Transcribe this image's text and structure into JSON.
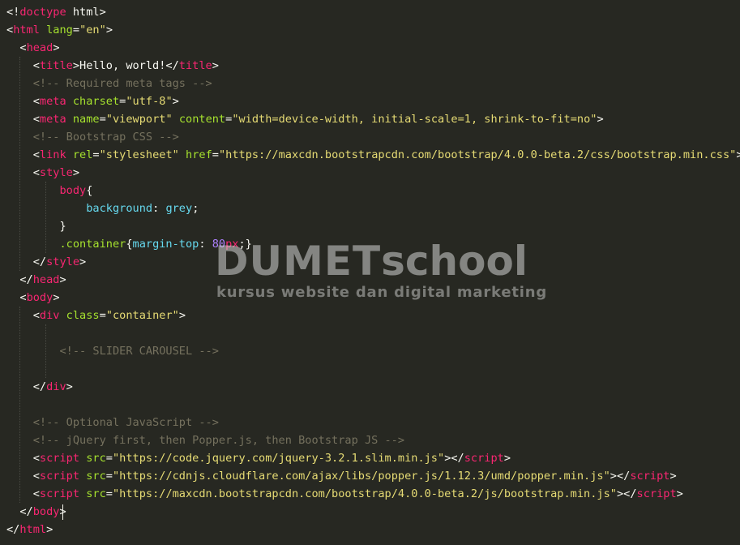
{
  "colors": {
    "background": "#272822",
    "tag": "#f92672",
    "attribute": "#a6e22e",
    "string": "#e6db74",
    "comment": "#75715e",
    "number": "#ae81ff",
    "css_property": "#66d9ef",
    "text": "#f8f8f2"
  },
  "watermark": {
    "brand_main": "DUMET",
    "brand_suffix": "school",
    "tagline": "kursus website dan digital marketing"
  },
  "code": {
    "lines": [
      [
        [
          "pl",
          "<!"
        ],
        [
          "tag",
          "doctype"
        ],
        [
          "pl",
          " html>"
        ]
      ],
      [
        [
          "pl",
          "<"
        ],
        [
          "tag",
          "html"
        ],
        [
          "pl",
          " "
        ],
        [
          "attr",
          "lang"
        ],
        [
          "pl",
          "="
        ],
        [
          "str",
          "\"en\""
        ],
        [
          "pl",
          ">"
        ]
      ],
      [
        [
          "pl",
          "  <"
        ],
        [
          "tag",
          "head"
        ],
        [
          "pl",
          ">"
        ]
      ],
      [
        [
          "pl",
          "    <"
        ],
        [
          "tag",
          "title"
        ],
        [
          "pl",
          ">Hello, world!</"
        ],
        [
          "tag",
          "title"
        ],
        [
          "pl",
          ">"
        ]
      ],
      [
        [
          "cm",
          "    <!-- Required meta tags -->"
        ]
      ],
      [
        [
          "pl",
          "    <"
        ],
        [
          "tag",
          "meta"
        ],
        [
          "pl",
          " "
        ],
        [
          "attr",
          "charset"
        ],
        [
          "pl",
          "="
        ],
        [
          "str",
          "\"utf-8\""
        ],
        [
          "pl",
          ">"
        ]
      ],
      [
        [
          "pl",
          "    <"
        ],
        [
          "tag",
          "meta"
        ],
        [
          "pl",
          " "
        ],
        [
          "attr",
          "name"
        ],
        [
          "pl",
          "="
        ],
        [
          "str",
          "\"viewport\""
        ],
        [
          "pl",
          " "
        ],
        [
          "attr",
          "content"
        ],
        [
          "pl",
          "="
        ],
        [
          "str",
          "\"width=device-width, initial-scale=1, shrink-to-fit=no\""
        ],
        [
          "pl",
          ">"
        ]
      ],
      [
        [
          "cm",
          "    <!-- Bootstrap CSS -->"
        ]
      ],
      [
        [
          "pl",
          "    <"
        ],
        [
          "tag",
          "link"
        ],
        [
          "pl",
          " "
        ],
        [
          "attr",
          "rel"
        ],
        [
          "pl",
          "="
        ],
        [
          "str",
          "\"stylesheet\""
        ],
        [
          "pl",
          " "
        ],
        [
          "attr",
          "href"
        ],
        [
          "pl",
          "="
        ],
        [
          "str",
          "\"https://maxcdn.bootstrapcdn.com/bootstrap/4.0.0-beta.2/css/bootstrap.min.css\""
        ],
        [
          "pl",
          ">"
        ]
      ],
      [
        [
          "pl",
          "    <"
        ],
        [
          "tag",
          "style"
        ],
        [
          "pl",
          ">"
        ]
      ],
      [
        [
          "pl",
          "        "
        ],
        [
          "tag",
          "body"
        ],
        [
          "pl",
          "{"
        ]
      ],
      [
        [
          "pl",
          "            "
        ],
        [
          "kw",
          "background"
        ],
        [
          "pl",
          ": "
        ],
        [
          "kw",
          "grey"
        ],
        [
          "pl",
          ";"
        ]
      ],
      [
        [
          "pl",
          "        }"
        ]
      ],
      [
        [
          "pl",
          "        "
        ],
        [
          "attr",
          ".container"
        ],
        [
          "pl",
          "{"
        ],
        [
          "kw",
          "margin-top"
        ],
        [
          "pl",
          ": "
        ],
        [
          "num",
          "80"
        ],
        [
          "tag",
          "px"
        ],
        [
          "pl",
          ";}"
        ]
      ],
      [
        [
          "pl",
          "    </"
        ],
        [
          "tag",
          "style"
        ],
        [
          "pl",
          ">"
        ]
      ],
      [
        [
          "pl",
          "  </"
        ],
        [
          "tag",
          "head"
        ],
        [
          "pl",
          ">"
        ]
      ],
      [
        [
          "pl",
          "  <"
        ],
        [
          "tag",
          "body"
        ],
        [
          "pl",
          ">"
        ]
      ],
      [
        [
          "pl",
          "    <"
        ],
        [
          "tag",
          "div"
        ],
        [
          "pl",
          " "
        ],
        [
          "attr",
          "class"
        ],
        [
          "pl",
          "="
        ],
        [
          "str",
          "\"container\""
        ],
        [
          "pl",
          ">"
        ]
      ],
      [],
      [
        [
          "cm",
          "        <!-- SLIDER CAROUSEL -->"
        ]
      ],
      [],
      [
        [
          "pl",
          "    </"
        ],
        [
          "tag",
          "div"
        ],
        [
          "pl",
          ">"
        ]
      ],
      [],
      [
        [
          "cm",
          "    <!-- Optional JavaScript -->"
        ]
      ],
      [
        [
          "cm",
          "    <!-- jQuery first, then Popper.js, then Bootstrap JS -->"
        ]
      ],
      [
        [
          "pl",
          "    <"
        ],
        [
          "tag",
          "script"
        ],
        [
          "pl",
          " "
        ],
        [
          "attr",
          "src"
        ],
        [
          "pl",
          "="
        ],
        [
          "str",
          "\"https://code.jquery.com/jquery-3.2.1.slim.min.js\""
        ],
        [
          "pl",
          "></"
        ],
        [
          "tag",
          "script"
        ],
        [
          "pl",
          ">"
        ]
      ],
      [
        [
          "pl",
          "    <"
        ],
        [
          "tag",
          "script"
        ],
        [
          "pl",
          " "
        ],
        [
          "attr",
          "src"
        ],
        [
          "pl",
          "="
        ],
        [
          "str",
          "\"https://cdnjs.cloudflare.com/ajax/libs/popper.js/1.12.3/umd/popper.min.js\""
        ],
        [
          "pl",
          "></"
        ],
        [
          "tag",
          "script"
        ],
        [
          "pl",
          ">"
        ]
      ],
      [
        [
          "pl",
          "    <"
        ],
        [
          "tag",
          "script"
        ],
        [
          "pl",
          " "
        ],
        [
          "attr",
          "src"
        ],
        [
          "pl",
          "="
        ],
        [
          "str",
          "\"https://maxcdn.bootstrapcdn.com/bootstrap/4.0.0-beta.2/js/bootstrap.min.js\""
        ],
        [
          "pl",
          "></"
        ],
        [
          "tag",
          "script"
        ],
        [
          "pl",
          ">"
        ]
      ],
      [
        [
          "pl",
          "  </"
        ],
        [
          "tag",
          "body"
        ],
        [
          "pl",
          ">"
        ]
      ],
      [
        [
          "pl",
          "</"
        ],
        [
          "tag",
          "html"
        ],
        [
          "pl",
          ">"
        ]
      ]
    ]
  }
}
